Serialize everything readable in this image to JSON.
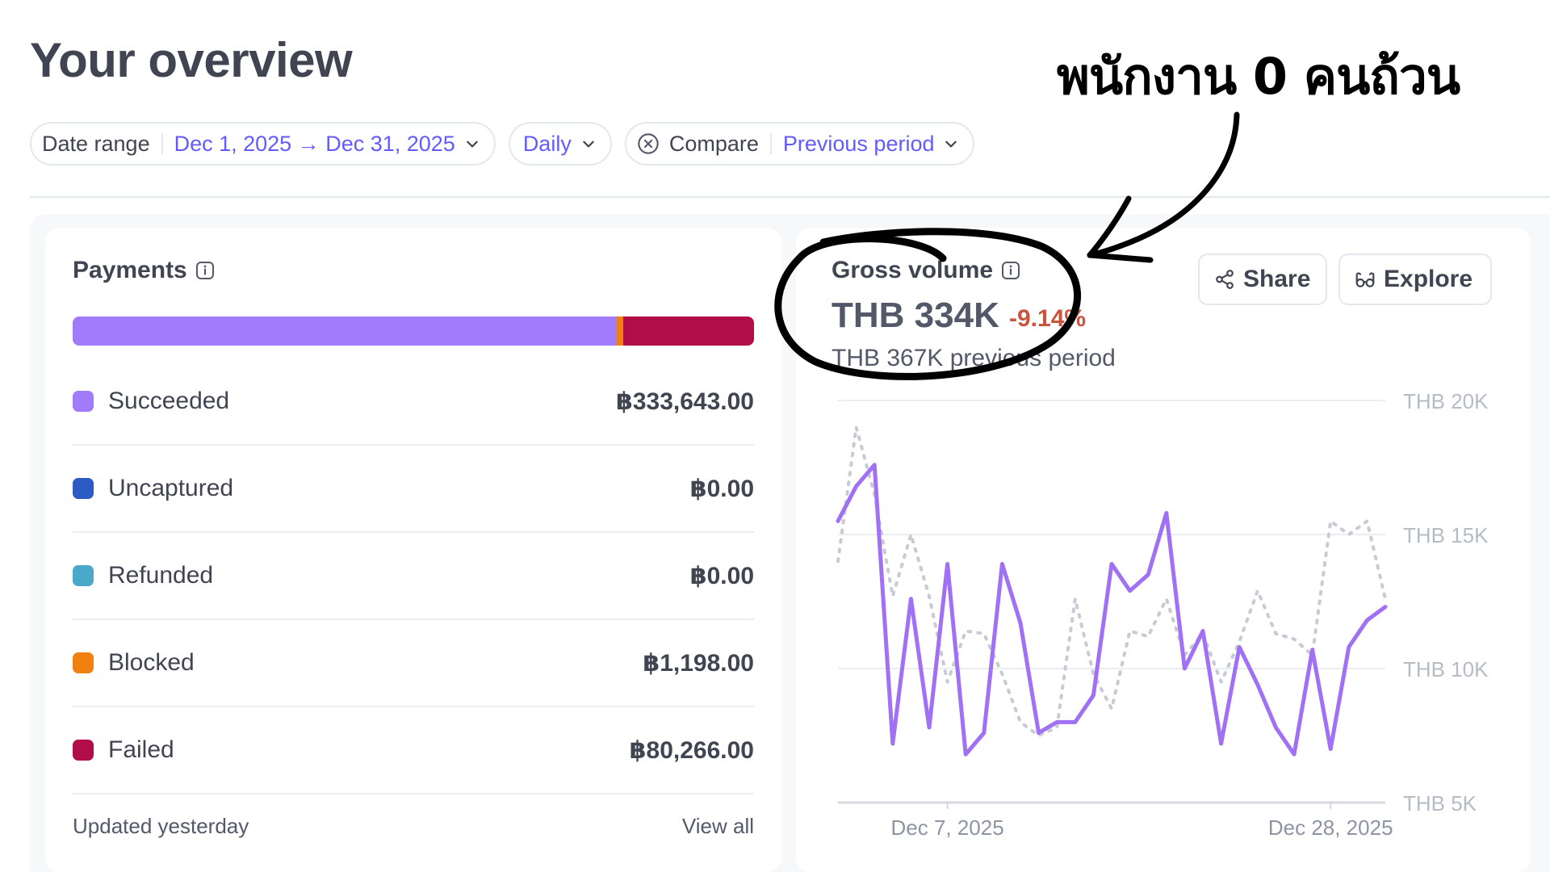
{
  "page": {
    "title": "Your overview"
  },
  "filters": {
    "date_range": {
      "label": "Date range",
      "value": "Dec 1, 2025 → Dec 31, 2025"
    },
    "interval": {
      "value": "Daily"
    },
    "compare": {
      "label": "Compare",
      "value": "Previous period"
    }
  },
  "payments": {
    "title": "Payments",
    "statuses": [
      {
        "name": "Succeeded",
        "amount": "฿333,643.00",
        "value": 333643.0,
        "color": "#a07cfa"
      },
      {
        "name": "Uncaptured",
        "amount": "฿0.00",
        "value": 0,
        "color": "#2c5bc6"
      },
      {
        "name": "Refunded",
        "amount": "฿0.00",
        "value": 0,
        "color": "#4aa8c9"
      },
      {
        "name": "Blocked",
        "amount": "฿1,198.00",
        "value": 1198.0,
        "color": "#f0800f"
      },
      {
        "name": "Failed",
        "amount": "฿80,266.00",
        "value": 80266.0,
        "color": "#b10d48"
      }
    ],
    "updated": "Updated yesterday",
    "view_all": "View all"
  },
  "gross_volume": {
    "title": "Gross volume",
    "value": "THB 334K",
    "delta": "-9.14%",
    "previous": "THB 367K previous period",
    "share_label": "Share",
    "explore_label": "Explore"
  },
  "chart_data": {
    "type": "line",
    "title": "Gross volume",
    "x_tick_labels": [
      "Dec 7, 2025",
      "Dec 28, 2025"
    ],
    "y_tick_labels": [
      "THB 20K",
      "THB 15K",
      "THB 10K",
      "THB 5K"
    ],
    "ylim": [
      5000,
      20000
    ],
    "grid": true,
    "series": [
      {
        "style": "solid",
        "color": "#a070f5",
        "values": [
          15500,
          16800,
          17600,
          7200,
          12600,
          7800,
          13900,
          6800,
          7600,
          13900,
          11700,
          7600,
          8000,
          8000,
          9000,
          13900,
          12900,
          13500,
          15800,
          10000,
          11400,
          7200,
          10800,
          9400,
          7800,
          6800,
          10700,
          7000,
          10800,
          11800,
          12300
        ]
      },
      {
        "style": "dashed",
        "color": "#c7cbd3",
        "values": [
          14000,
          19000,
          16500,
          12700,
          15000,
          12700,
          9500,
          11400,
          11300,
          9800,
          8000,
          7500,
          7800,
          12600,
          9800,
          8500,
          11400,
          11200,
          12600,
          10500,
          11300,
          9500,
          11000,
          12900,
          11300,
          11100,
          10500,
          15500,
          15000,
          15500,
          12600
        ]
      }
    ]
  },
  "annotation": {
    "text": "พนักงาน 0 คนถ้วน"
  }
}
